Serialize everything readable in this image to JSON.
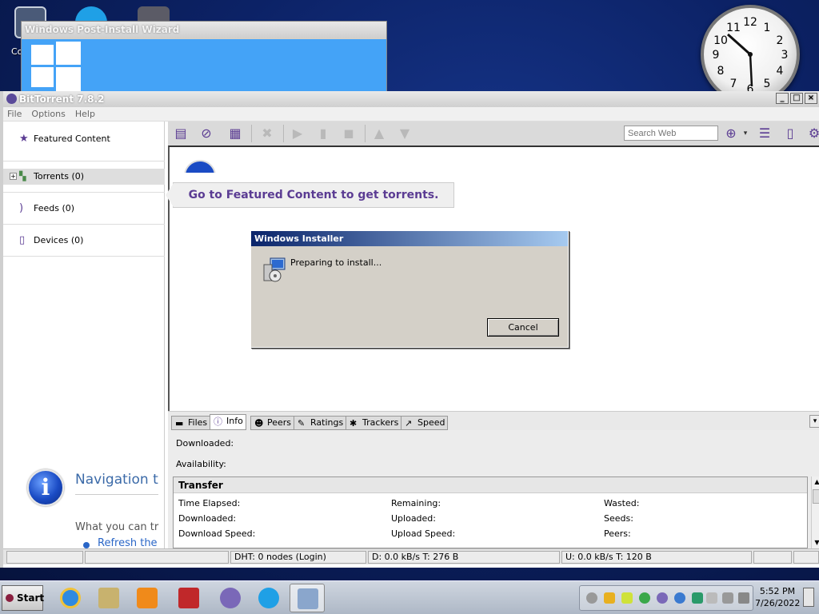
{
  "desktop": {
    "icons": [
      {
        "label": "Co"
      },
      {
        "label": ""
      },
      {
        "label": ""
      }
    ],
    "clock": {
      "numbers": [
        "12",
        "1",
        "2",
        "3",
        "4",
        "5",
        "6",
        "7",
        "8",
        "9",
        "10",
        "11"
      ]
    }
  },
  "wizard": {
    "title": "Windows Post-Install Wizard"
  },
  "bittorrent": {
    "title": "BitTorrent 7.8.2",
    "window_controls": [
      "_",
      "□",
      "×"
    ],
    "menu": [
      "File",
      "Options",
      "Help"
    ],
    "sidebar": {
      "items": [
        {
          "label": "Featured Content",
          "icon": "star-icon"
        },
        {
          "label": "Torrents (0)",
          "icon": "torrents-icon"
        },
        {
          "label": "Feeds (0)",
          "icon": "rss-icon"
        },
        {
          "label": "Devices (0)",
          "icon": "device-icon"
        }
      ],
      "nav_panel": {
        "heading": "Navigation t",
        "body": "What you can tr",
        "link": "Refresh the"
      }
    },
    "toolbar": {
      "search_placeholder": "Search Web"
    },
    "featured_banner": "Go to Featured Content to get torrents.",
    "tabs": [
      {
        "label": "Files",
        "icon": "folder-icon"
      },
      {
        "label": "Info",
        "icon": "info-icon",
        "active": true
      },
      {
        "label": "Peers",
        "icon": "peers-icon"
      },
      {
        "label": "Ratings",
        "icon": "ratings-icon"
      },
      {
        "label": "Trackers",
        "icon": "trackers-icon"
      },
      {
        "label": "Speed",
        "icon": "speed-icon"
      }
    ],
    "info": {
      "downloaded_label": "Downloaded:",
      "availability_label": "Availability:",
      "transfer_title": "Transfer",
      "col1": [
        "Time Elapsed:",
        "Downloaded:",
        "Download Speed:"
      ],
      "col2": [
        "Remaining:",
        "Uploaded:",
        "Upload Speed:"
      ],
      "col3": [
        "Wasted:",
        "Seeds:",
        "Peers:"
      ]
    },
    "statusbar": {
      "dht": "DHT: 0 nodes (Login)",
      "download": "D: 0.0 kB/s T: 276 B",
      "upload": "U: 0.0 kB/s T: 120 B"
    }
  },
  "installer": {
    "title": "Windows Installer",
    "message": "Preparing to install...",
    "cancel_label": "Cancel"
  },
  "taskbar": {
    "start_label": "Start",
    "time": "5:52 PM",
    "date": "7/26/2022"
  }
}
